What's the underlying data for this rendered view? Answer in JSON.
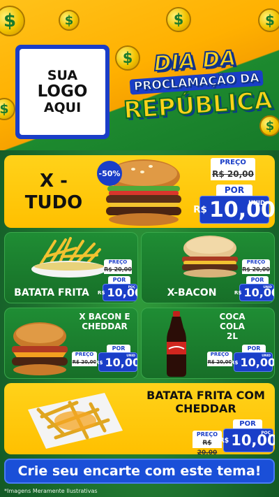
{
  "header": {
    "logo_lines": [
      "SUA",
      "LOGO",
      "AQUI"
    ],
    "title_line1": "DIA DA",
    "title_line2": "PROCLAMAÇÃO DA",
    "title_line3": "REPÚBLICA",
    "coin_symbol": "$"
  },
  "products": [
    {
      "name_line1": "X -",
      "name_line2": "TUDO",
      "discount": "-50%",
      "preco_label": "PREÇO",
      "old_price": "R$ 20,00",
      "por_label": "POR",
      "currency": "R$",
      "new_price": "10,00",
      "unit": "UNID"
    },
    {
      "name": "BATATA FRITA",
      "preco_label": "PREÇO",
      "old_price": "R$ 20,00",
      "por_label": "POR",
      "currency": "R$",
      "new_price": "10,00",
      "unit": "POÇ"
    },
    {
      "name": "X-BACON",
      "preco_label": "PREÇO",
      "old_price": "R$ 20,00",
      "por_label": "POR",
      "currency": "R$",
      "new_price": "10,00",
      "unit": "UNID"
    },
    {
      "name_line1": "X BACON E",
      "name_line2": "CHEDDAR",
      "preco_label": "PREÇO",
      "old_price": "R$ 20,00",
      "por_label": "POR",
      "currency": "R$",
      "new_price": "10,00",
      "unit": "UNID"
    },
    {
      "name_line1": "COCA COLA",
      "name_line2": "2L",
      "preco_label": "PREÇO",
      "old_price": "R$ 20,00",
      "por_label": "POR",
      "currency": "R$",
      "new_price": "10,00",
      "unit": "UNID"
    },
    {
      "name_line1": "BATATA FRITA COM",
      "name_line2": "CHEDDAR",
      "preco_label": "PREÇO",
      "old_price": "R$ 20,00",
      "por_label": "POR",
      "currency": "R$",
      "new_price": "10,00",
      "unit": "POÇ"
    }
  ],
  "cta": {
    "label": "Crie seu encarte com este tema!"
  },
  "footnote": "*Imagens Meramente Ilustrativas",
  "colors": {
    "yellow": "#ffc000",
    "green": "#1f8d34",
    "blue": "#1a3ec8"
  }
}
